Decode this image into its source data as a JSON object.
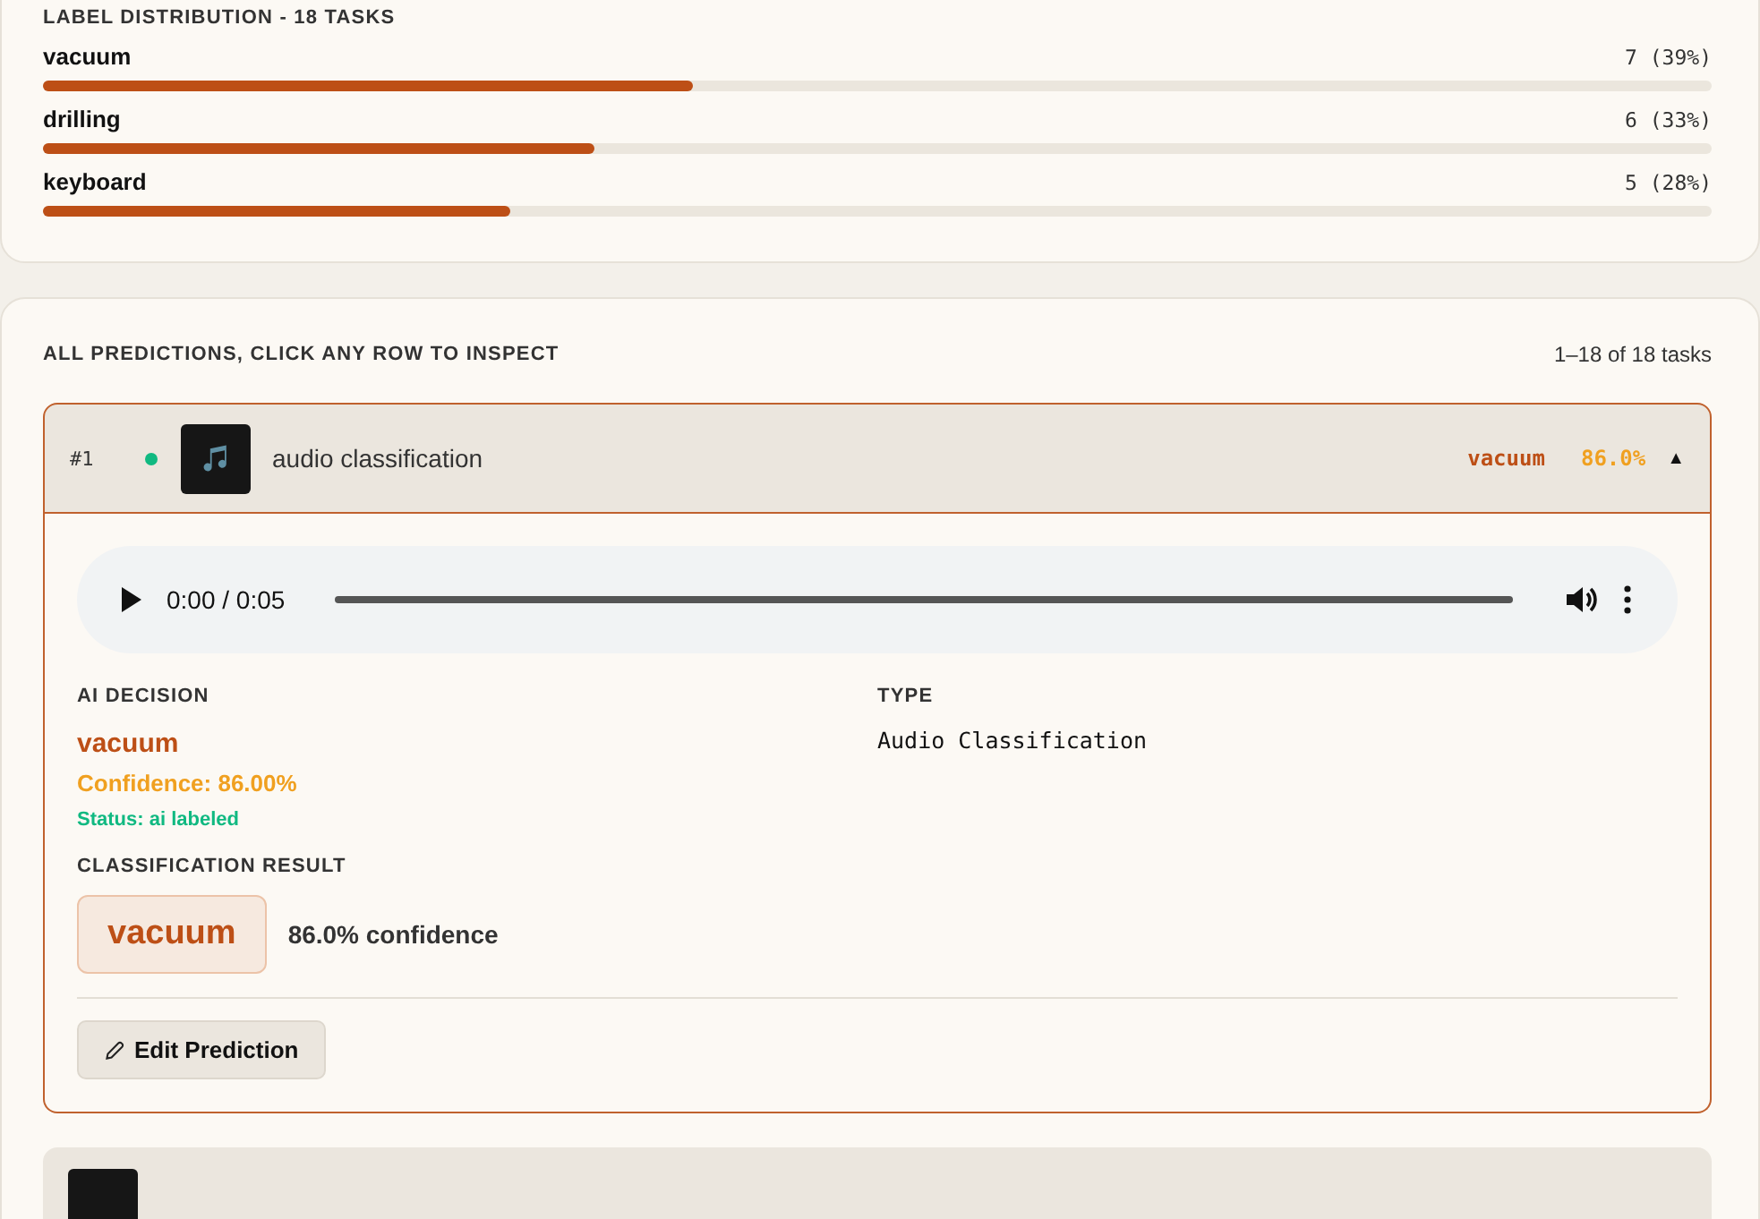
{
  "distribution": {
    "title": "LABEL DISTRIBUTION - 18 TASKS",
    "labels": [
      {
        "name": "vacuum",
        "count": "7 (39%)",
        "level": 0.39
      },
      {
        "name": "drilling",
        "count": "6 (33%)",
        "level": 0.33
      },
      {
        "name": "keyboard",
        "count": "5 (28%)",
        "level": 0.28
      }
    ]
  },
  "predictions": {
    "title": "ALL PREDICTIONS, CLICK ANY ROW TO INSPECT",
    "range": "1–18 of 18 tasks",
    "rows": [
      {
        "index": "#1",
        "color": "#10b981",
        "name": "audio classification",
        "label": "vacuum",
        "confidence": "86.0%",
        "caret": "▲",
        "expanded": true,
        "detail": {
          "player": {
            "time": "0:00 / 0:05"
          },
          "decision_heading": "AI DECISION",
          "decision": "vacuum",
          "confidence": "Confidence: 86.00%",
          "status": "Status: ai labeled",
          "type_heading": "TYPE",
          "type": "Audio Classification",
          "result_heading": "CLASSIFICATION RESULT",
          "result_label": "vacuum",
          "result_confidence": "86.0% confidence",
          "edit_button": "Edit Prediction"
        }
      },
      {
        "expanded": false
      }
    ]
  }
}
